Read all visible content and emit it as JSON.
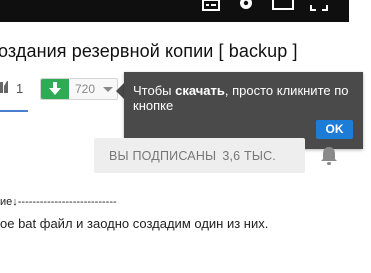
{
  "player": {
    "controls": [
      "subtitles-icon",
      "gear-icon",
      "theater-icon",
      "fullscreen-icon"
    ]
  },
  "video": {
    "title": "оздания резервной копии [ backup ]"
  },
  "likes": {
    "count": "1"
  },
  "download": {
    "count": "720"
  },
  "tooltip": {
    "text_before": "Чтобы ",
    "text_bold": "скачать",
    "text_after": ", просто кликните по кнопке",
    "ok_label": "OK"
  },
  "subscribe": {
    "label": "ВЫ ПОДПИСАНЫ",
    "count": "3,6 ТЫС."
  },
  "description": {
    "line1": "ие↓---------------------------",
    "line2": "ое bat файл и заодно создадим один из них."
  },
  "colors": {
    "player_bg": "#0f0f0f",
    "download_green": "#2faa55",
    "tooltip_bg": "#4a4a4a",
    "ok_blue": "#1c7cd6"
  }
}
